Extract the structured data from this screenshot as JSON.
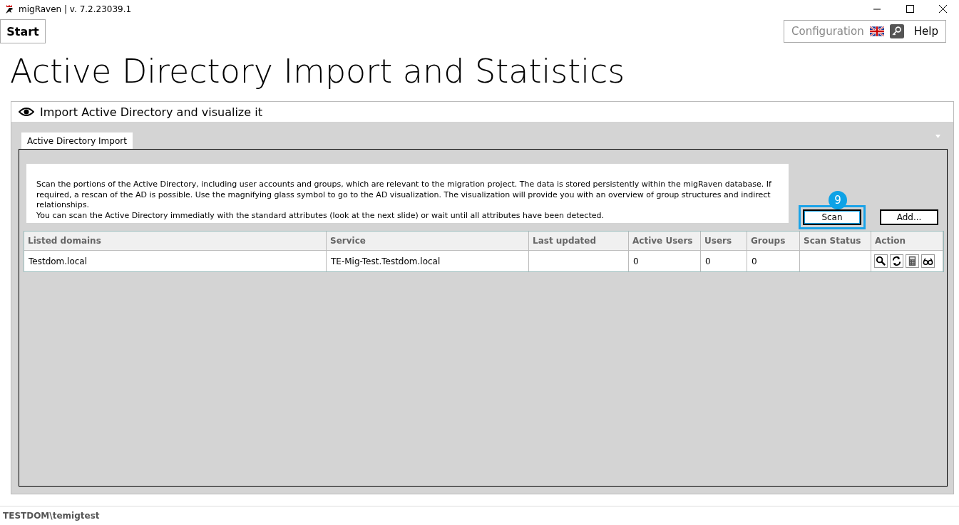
{
  "window": {
    "title": "migRaven | v. 7.2.23039.1"
  },
  "toolbar": {
    "start": "Start",
    "configuration": "Configuration",
    "help": "Help"
  },
  "heading": "Active Directory Import and Statistics",
  "panel": {
    "title": "Import Active Directory and visualize it",
    "tabs": [
      {
        "label": "Active Directory Import",
        "selected": true
      }
    ],
    "description": [
      "Scan the portions of the Active Directory, including user accounts and groups, which are relevant to the migration project. The data is stored persistently within the migRaven database. If required, a rescan of the AD is possible. Use the magnifying glass symbol to go to the AD visualization. The visualization will provide you with an overview of group structures and indirect relationships.",
      "You can scan the Active Directory immediatly with the standard attributes (look at the next slide) or wait until all attributes have been detected."
    ],
    "step_badge": "9",
    "buttons": [
      {
        "label": "Scan",
        "highlighted": true
      },
      {
        "label": "Add...",
        "highlighted": false
      }
    ],
    "table": {
      "columns": [
        "Listed domains",
        "Service",
        "Last updated",
        "Active Users",
        "Users",
        "Groups",
        "Scan Status",
        "Action"
      ],
      "rows": [
        {
          "cells": [
            "Testdom.local",
            "TE-Mig-Test.Testdom.local",
            "",
            "0",
            "0",
            "0",
            ""
          ]
        }
      ]
    }
  },
  "status_bar": "TESTDOM\\temigtest"
}
